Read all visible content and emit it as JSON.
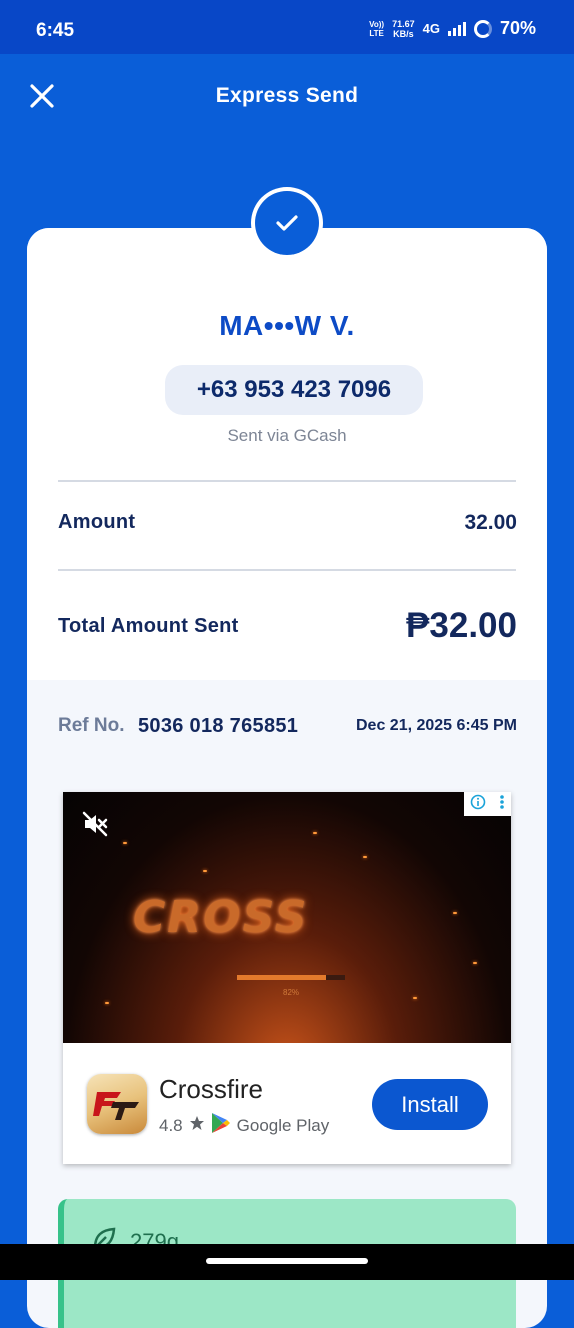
{
  "status_bar": {
    "time": "6:45",
    "volte_line1": "Vo))",
    "volte_line2": "LTE",
    "speed_value": "71.67",
    "speed_unit": "KB/s",
    "network": "4G",
    "battery": "70%"
  },
  "header": {
    "title": "Express Send",
    "close_icon": "close-icon"
  },
  "receipt": {
    "status_icon": "check-circle-icon",
    "recipient_name": "MA•••W V.",
    "phone": "+63 953 423 7096",
    "sent_via": "Sent via GCash",
    "amount_label": "Amount",
    "amount_value": "32.00",
    "total_label": "Total Amount Sent",
    "currency_symbol": "₱",
    "total_value": "32.00",
    "ref_label": "Ref No.",
    "ref_number": "5036 018 765851",
    "date": "Dec 21, 2025 6:45 PM"
  },
  "ad": {
    "mute_icon": "volume-off-icon",
    "info_icon": "info-icon",
    "menu_icon": "more-vert-icon",
    "video_logo": "CROSS",
    "loading_percent": "82%",
    "loading_fraction": 0.82,
    "app_name": "Crossfire",
    "rating": "4.8",
    "store": "Google Play",
    "install_label": "Install"
  },
  "green_card": {
    "value": "279g"
  },
  "colors": {
    "primary": "#0a5ed8",
    "status_bar": "#0847c7",
    "text_dark": "#13285d",
    "accent_name": "#0d4bc6",
    "install": "#0b57d0",
    "green_card": "#9ce7c6"
  }
}
